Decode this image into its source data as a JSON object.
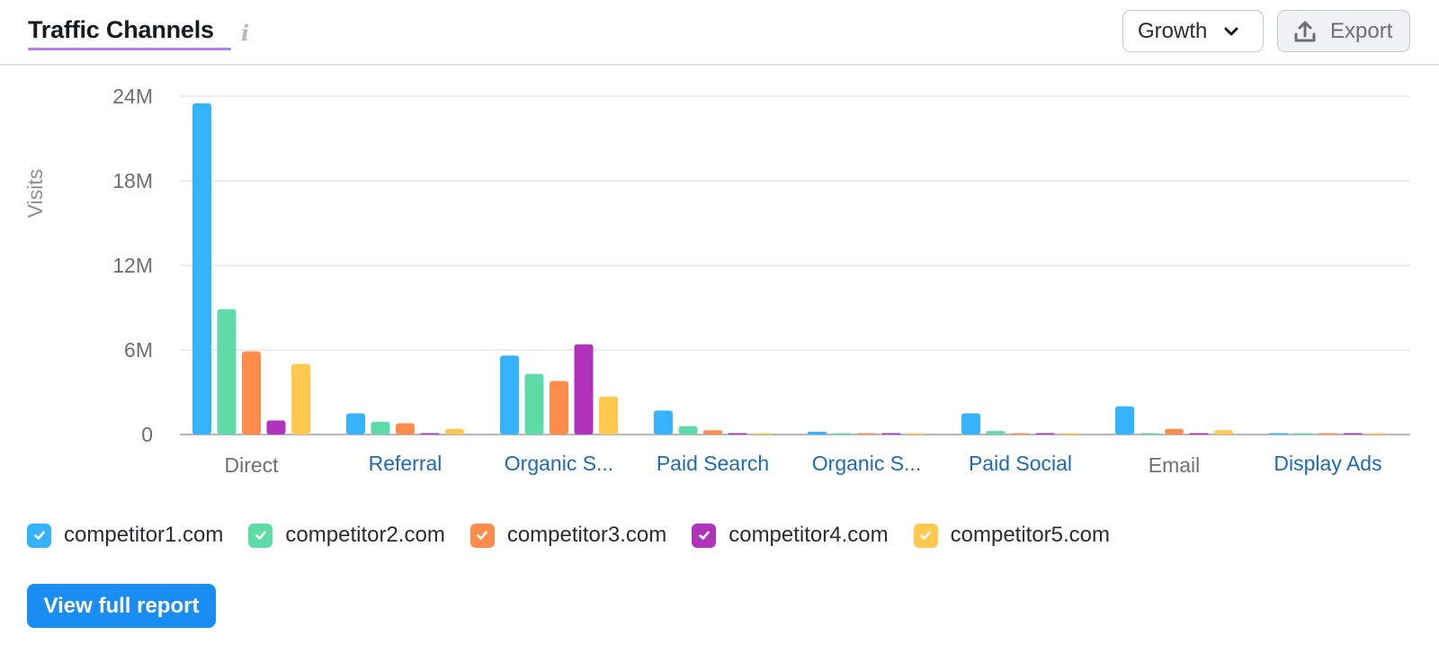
{
  "header": {
    "title": "Traffic Channels",
    "info_icon": "info-icon",
    "mode_dropdown": {
      "selected": "Growth",
      "icon": "chevron-down-icon"
    },
    "export_button": {
      "label": "Export",
      "icon": "upload-icon"
    }
  },
  "footer": {
    "view_report_label": "View full report",
    "accent_color": "#1a8df2"
  },
  "chart_data": {
    "type": "bar",
    "title": "Traffic Channels",
    "xlabel": "",
    "ylabel": "Visits",
    "ylim": [
      0,
      24000000
    ],
    "yticks": [
      0,
      6000000,
      12000000,
      18000000,
      24000000
    ],
    "ytick_labels": [
      "0",
      "6M",
      "12M",
      "18M",
      "24M"
    ],
    "grid": true,
    "legend_position": "bottom-left",
    "categories": [
      "Direct",
      "Referral",
      "Organic S...",
      "Paid Search",
      "Organic S...",
      "Paid Social",
      "Email",
      "Display Ads"
    ],
    "category_link": [
      false,
      true,
      true,
      true,
      true,
      true,
      false,
      true
    ],
    "series": [
      {
        "name": "competitor1.com",
        "color": "#36b3ff",
        "checked": true,
        "values": [
          23500000,
          1500000,
          5600000,
          1700000,
          200000,
          1500000,
          2000000,
          50000
        ]
      },
      {
        "name": "competitor2.com",
        "color": "#5fdba7",
        "checked": true,
        "values": [
          8900000,
          900000,
          4300000,
          600000,
          20000,
          250000,
          10000,
          20000
        ]
      },
      {
        "name": "competitor3.com",
        "color": "#ff8c4a",
        "checked": true,
        "values": [
          5900000,
          800000,
          3800000,
          300000,
          20000,
          20000,
          400000,
          20000
        ]
      },
      {
        "name": "competitor4.com",
        "color": "#b032bd",
        "checked": true,
        "values": [
          1000000,
          20000,
          6400000,
          20000,
          20000,
          20000,
          20000,
          20000
        ]
      },
      {
        "name": "competitor5.com",
        "color": "#ffc84f",
        "checked": true,
        "values": [
          5000000,
          400000,
          2700000,
          50000,
          20000,
          10000,
          300000,
          20000
        ]
      }
    ]
  }
}
